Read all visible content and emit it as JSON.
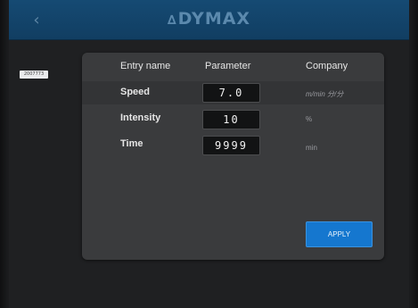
{
  "header": {
    "back_icon_glyph": "‹",
    "logo_mark": "∆",
    "logo_text": "DYMAX"
  },
  "side_tag": {
    "label": "2007773"
  },
  "table": {
    "headers": {
      "entry_name": "Entry name",
      "parameter": "Parameter",
      "company": "Company"
    },
    "rows": [
      {
        "label": "Speed",
        "value": "7.0",
        "unit": "m/min   分/分"
      },
      {
        "label": "Intensity",
        "value": "10",
        "unit": "%"
      },
      {
        "label": "Time",
        "value": "9999",
        "unit": "min"
      }
    ]
  },
  "actions": {
    "apply_label": "APPLY"
  },
  "colors": {
    "header_blue": "#154a73",
    "logo_blue": "#5b89ad",
    "panel_gray": "#3a3b3d",
    "apply_blue": "#1577cf"
  },
  "icons": {
    "back": "chevron-left-icon",
    "logo": "dymax-logo"
  }
}
